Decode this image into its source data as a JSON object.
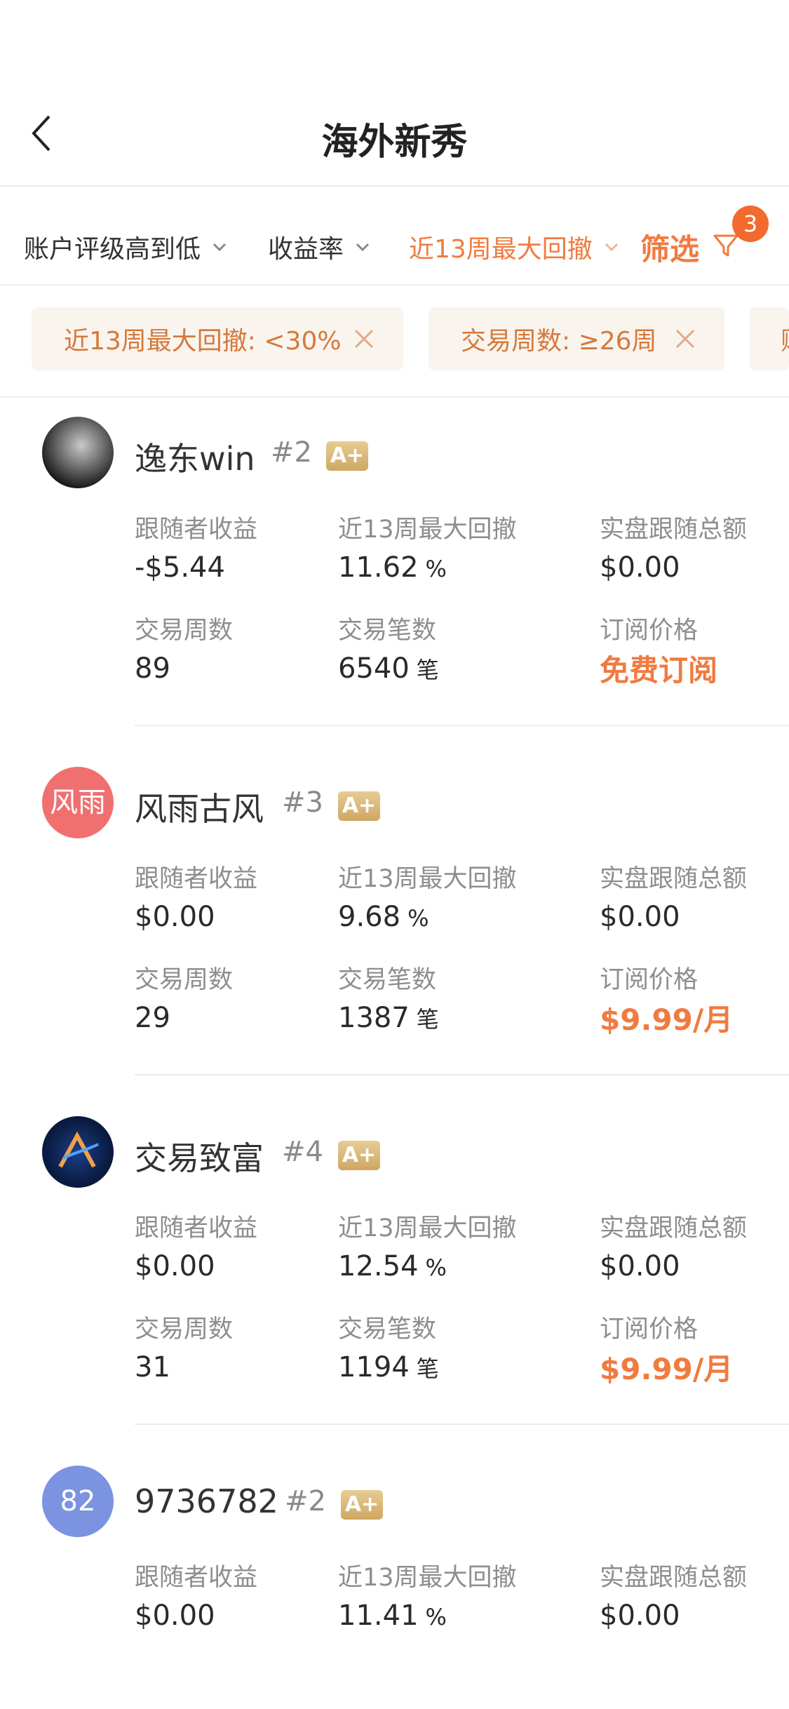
{
  "header": {
    "title": "海外新秀"
  },
  "sort": {
    "items": [
      {
        "label": "账户评级高到低"
      },
      {
        "label": "收益率"
      },
      {
        "label": "近13周最大回撤"
      }
    ],
    "filter_label": "筛选",
    "filter_count": "3"
  },
  "chips": [
    {
      "label": "近13周最大回撤: <30%"
    },
    {
      "label": "交易周数: ≥26周"
    },
    {
      "label": "账"
    }
  ],
  "labels": {
    "follower_profit": "跟随者收益",
    "max_drawdown": "近13周最大回撤",
    "live_follow_total": "实盘跟随总额",
    "trade_weeks": "交易周数",
    "trade_count": "交易笔数",
    "subscribe_price": "订阅价格"
  },
  "units": {
    "percent": "%",
    "trades": "笔"
  },
  "traders": [
    {
      "name": "逸东win",
      "rank": "#2",
      "grade": "A+",
      "avatar_text": "",
      "follower_profit": "-$5.44",
      "max_drawdown": "11.62",
      "live_follow_total": "$0.00",
      "trade_weeks": "89",
      "trade_count": "6540",
      "subscribe_price": "免费订阅"
    },
    {
      "name": "风雨古风",
      "rank": "#3",
      "grade": "A+",
      "avatar_text": "风雨",
      "follower_profit": "$0.00",
      "max_drawdown": "9.68",
      "live_follow_total": "$0.00",
      "trade_weeks": "29",
      "trade_count": "1387",
      "subscribe_price": "$9.99/月"
    },
    {
      "name": "交易致富",
      "rank": "#4",
      "grade": "A+",
      "avatar_text": "",
      "follower_profit": "$0.00",
      "max_drawdown": "12.54",
      "live_follow_total": "$0.00",
      "trade_weeks": "31",
      "trade_count": "1194",
      "subscribe_price": "$9.99/月"
    },
    {
      "name": "9736782",
      "rank": "#2",
      "grade": "A+",
      "avatar_text": "82",
      "follower_profit": "$0.00",
      "max_drawdown": "11.41",
      "live_follow_total": "$0.00"
    }
  ],
  "colors": {
    "accent": "#f07b3f",
    "badge": "#f26a2e",
    "avatar_red": "#f07070",
    "avatar_blue": "#7b93e0"
  }
}
